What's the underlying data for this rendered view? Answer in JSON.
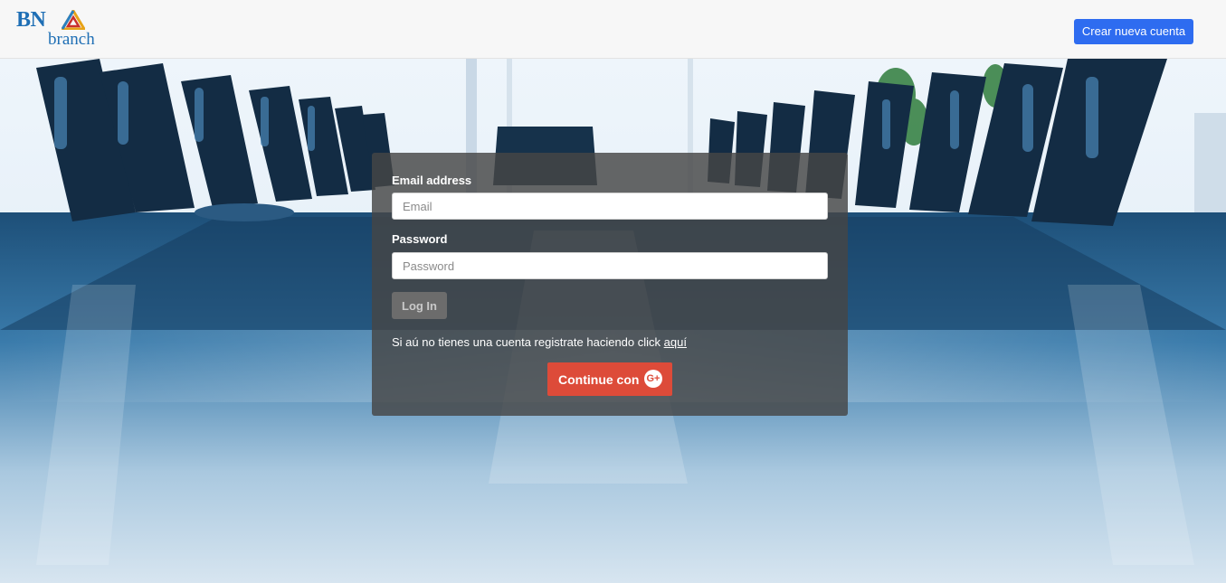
{
  "header": {
    "logo_text": "BN",
    "logo_subtext": "branch",
    "create_account_label": "Crear nueva cuenta"
  },
  "login": {
    "email_label": "Email address",
    "email_placeholder": "Email",
    "email_value": "",
    "password_label": "Password",
    "password_placeholder": "Password",
    "password_value": "",
    "login_label": "Log In",
    "hint_text": "Si aú no tienes una cuenta registrate haciendo click ",
    "hint_link": "aquí",
    "google_label": "Continue con",
    "google_icon": "google-plus-icon",
    "google_icon_text": "G+"
  },
  "colors": {
    "primary_button": "#2e6cf0",
    "google_button": "#dd4b39",
    "header_background": "#f7f7f7",
    "brand_blue": "#1f6fb5"
  }
}
